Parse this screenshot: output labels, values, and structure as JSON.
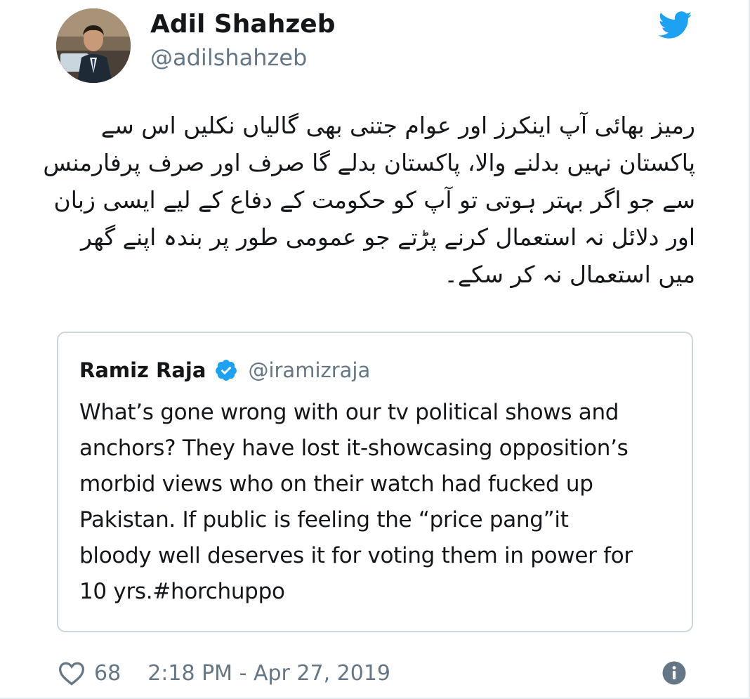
{
  "tweet": {
    "author": {
      "display_name": "Adil Shahzeb",
      "handle": "@adilshahzeb",
      "avatar_icon": "avatar-photo"
    },
    "brand_icon": "twitter-bird-icon",
    "brand_color": "#1da1f2",
    "text": "رمیز بھائی آپ اینکرز اور عوام جتنی بھی گالیاں نکلیں اس سے پاکستان نہیں بدلنے والا، پاکستان بدلے گا صرف اور صرف پرفارمنس سے جو اگر بہتر ہوتی تو آپ کو حکومت کے دفاع کے لیے ایسی زبان اور دلائل نہ استعمال کرنے پڑتے جو عمومی طور پر بندہ اپنے گھر میں استعمال نہ کر سکے۔",
    "quoted": {
      "display_name": "Ramiz Raja",
      "verified_icon": "verified-badge-icon",
      "handle": "@iramizraja",
      "text": "What’s gone wrong with our tv political shows and\nanchors? They have lost it-showcasing opposition’s\nmorbid views who on their watch had fucked up\nPakistan. If public is feeling the “price pang”it\nbloody well deserves it for voting them in power for\n10 yrs.#horchuppo"
    },
    "footer": {
      "like_icon": "heart-icon",
      "like_count": "68",
      "timestamp": "2:18 PM - Apr 27, 2019",
      "info_icon": "info-icon"
    }
  },
  "colors": {
    "text_primary": "#14171a",
    "text_secondary": "#657786",
    "border": "#ccd6dd",
    "verified": "#1da1f2"
  }
}
